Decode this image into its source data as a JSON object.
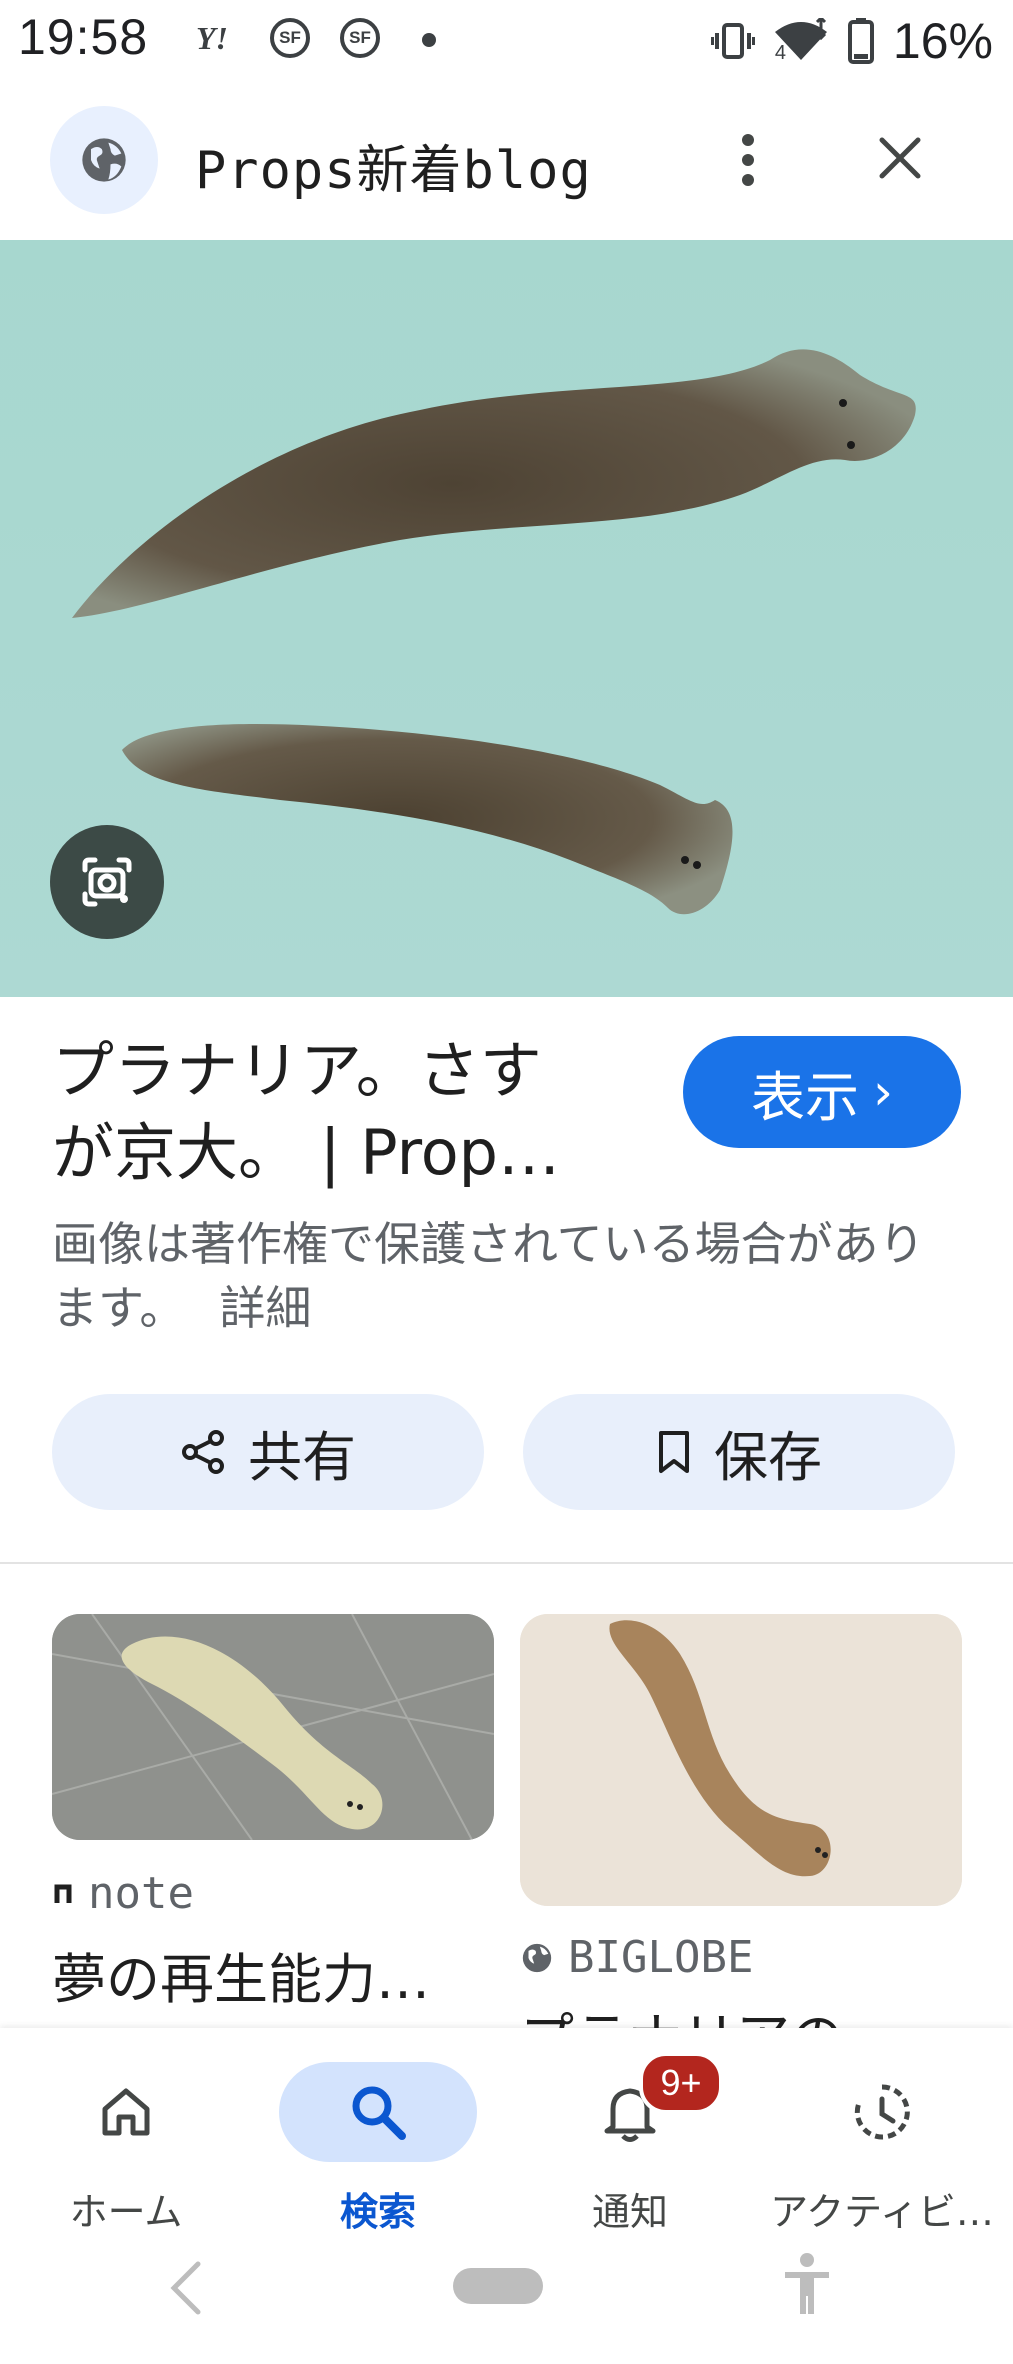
{
  "status_bar": {
    "time": "19:58",
    "yahoo": "Y!",
    "sf_1": "SF",
    "sf_2": "SF",
    "network": "4",
    "battery": "16%"
  },
  "header": {
    "site_title": "Props新着blog",
    "globe_icon": "globe-icon",
    "more_icon": "more-vert-icon",
    "close_icon": "close-icon"
  },
  "hero": {
    "lens_icon": "google-lens-icon",
    "colors": {
      "background": "#a9d9d2",
      "worm": "#5e5242"
    }
  },
  "result": {
    "title_line_1": "プラナリア。さす",
    "title_line_2": "が京大。 | Prop…",
    "view_button": "表示",
    "view_chevron": "›",
    "copyright": "画像は著作権で保護されている場合があります。",
    "details_link": "詳細"
  },
  "actions": {
    "share_label": "共有",
    "save_label": "保存"
  },
  "related": [
    {
      "source": "note",
      "title": "夢の再生能力…"
    },
    {
      "source": "BIGLOBE",
      "title": "プラナリアの…"
    }
  ],
  "bottom_nav": {
    "items": [
      {
        "label": "ホーム",
        "icon": "home-icon"
      },
      {
        "label": "検索",
        "icon": "search-icon"
      },
      {
        "label": "通知",
        "icon": "bell-icon",
        "badge": "9+"
      },
      {
        "label": "アクティビ…",
        "icon": "activity-icon"
      }
    ],
    "active": "検索"
  },
  "colors": {
    "accent": "#1a73e8",
    "active_nav": "#0b57d0",
    "badge": "#b3261e"
  }
}
